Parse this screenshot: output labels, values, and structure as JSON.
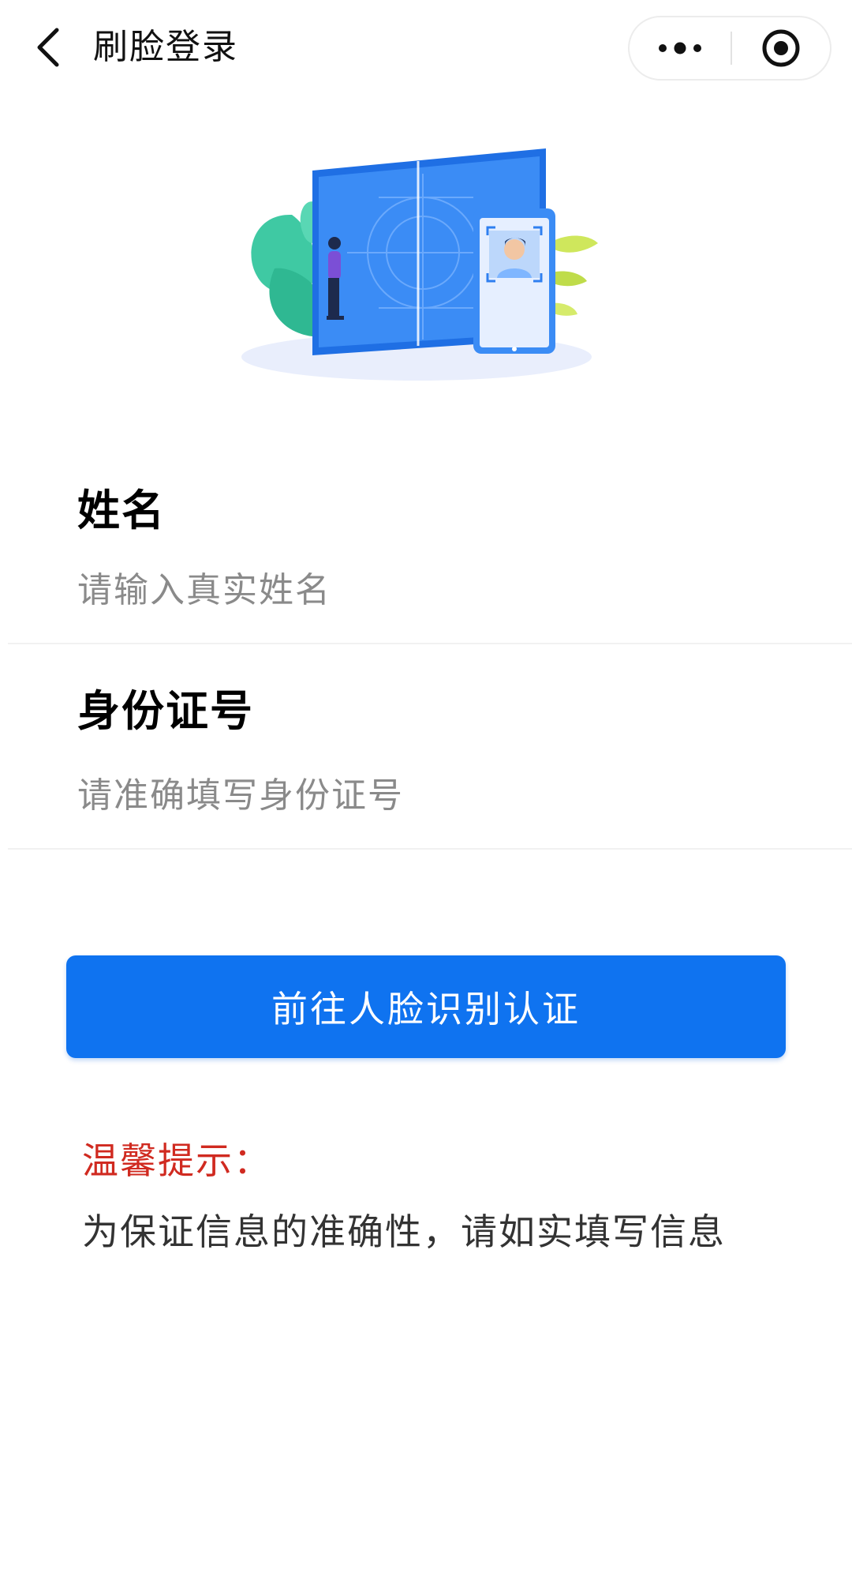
{
  "nav": {
    "title": "刷脸登录",
    "back_icon": "chevron-left-icon",
    "more_icon": "more-dots-icon",
    "close_icon": "target-close-icon"
  },
  "illustration": {
    "icon": "face-recognition-illustration",
    "colors": {
      "screen": "#2f7ff0",
      "leaf": "#43cfa9",
      "accent_leaf": "#cde65a",
      "person_shirt": "#7b4fd6"
    }
  },
  "form": {
    "name": {
      "label": "姓名",
      "placeholder": "请输入真实姓名",
      "value": ""
    },
    "id_number": {
      "label": "身份证号",
      "placeholder": "请准确填写身份证号",
      "value": ""
    }
  },
  "cta": {
    "label": "前往人脸识别认证",
    "color": "#0f73f0"
  },
  "notice": {
    "title": "温馨提示：",
    "text": "为保证信息的准确性，请如实填写信息",
    "title_color": "#d02a20"
  }
}
